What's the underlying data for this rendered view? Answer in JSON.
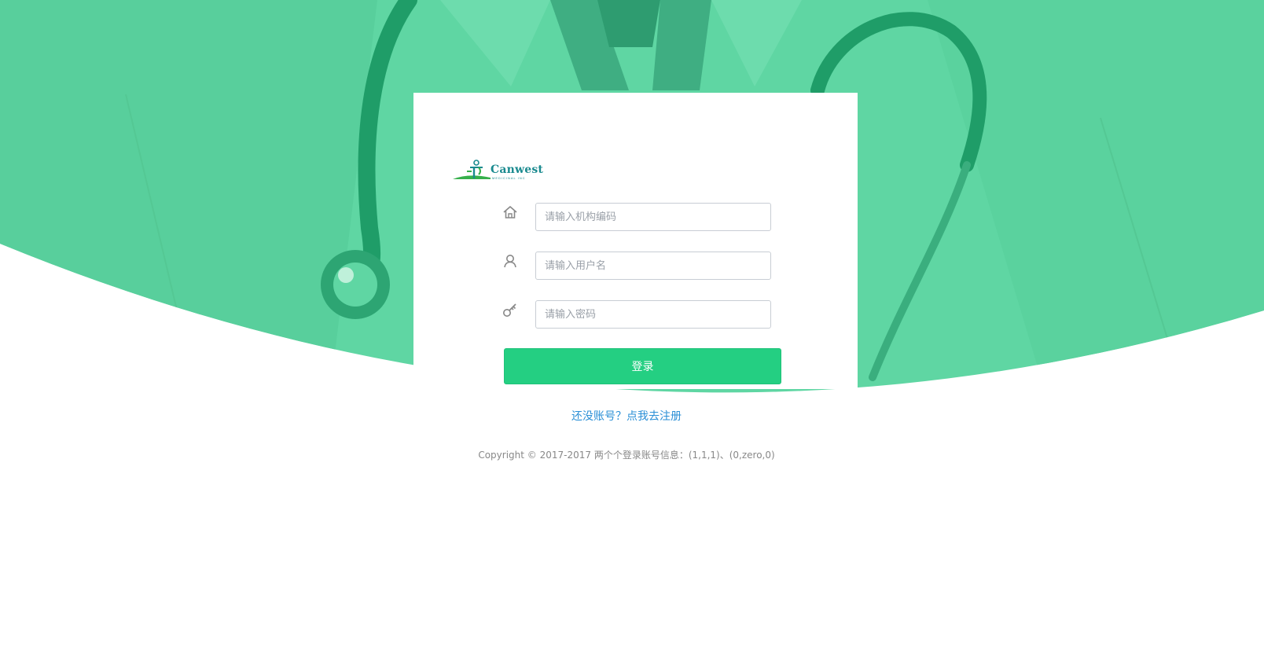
{
  "colors": {
    "hero_green": "#5fd6a3",
    "hero_dark": "#1f9d68",
    "button_green": "#24cf82",
    "link_blue": "#2a8fd6",
    "text_gray": "#888888"
  },
  "logo": {
    "text": "Canwest",
    "subtext": "MEDICINAL INC"
  },
  "form": {
    "org_code": {
      "icon": "home-icon",
      "placeholder": "请输入机构编码",
      "value": ""
    },
    "username": {
      "icon": "user-icon",
      "placeholder": "请输入用户名",
      "value": ""
    },
    "password": {
      "icon": "key-icon",
      "placeholder": "请输入密码",
      "value": ""
    },
    "submit_label": "登录"
  },
  "register_link": "还没账号？点我去注册",
  "copyright": "Copyright © 2017-2017 两个个登录账号信息：(1,1,1)、(0,zero,0)"
}
